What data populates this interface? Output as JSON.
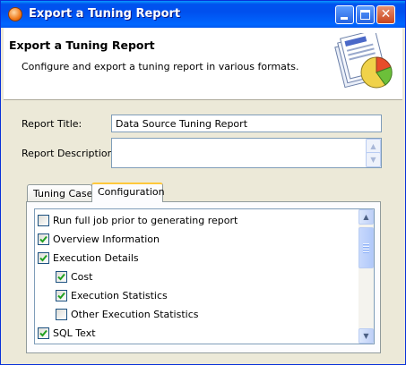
{
  "window": {
    "title": "Export a Tuning Report",
    "close_symbol": "✕"
  },
  "header": {
    "title": "Export a Tuning Report",
    "description": "Configure and export a tuning report in various formats.",
    "icon": "report-chart-icon"
  },
  "form": {
    "report_title_label": "Report Title:",
    "report_title_value": "Data Source Tuning Report",
    "report_description_label": "Report Description:",
    "report_description_value": ""
  },
  "tabs": [
    {
      "label": "Tuning Cases",
      "active": false
    },
    {
      "label": "Configuration",
      "active": true
    }
  ],
  "configuration": {
    "options": [
      {
        "label": "Run full job prior to generating report",
        "checked": false
      },
      {
        "label": "Overview Information",
        "checked": true
      },
      {
        "label": "Execution Details",
        "checked": true
      },
      {
        "label": "Cost",
        "checked": true
      },
      {
        "label": "Execution Statistics",
        "checked": true
      },
      {
        "label": "Other Execution Statistics",
        "checked": false
      },
      {
        "label": "SQL Text",
        "checked": true
      }
    ]
  },
  "colors": {
    "titlebar": "#0053EE",
    "active_tab_accent": "#FFC83C",
    "check_mark": "#21A121"
  }
}
